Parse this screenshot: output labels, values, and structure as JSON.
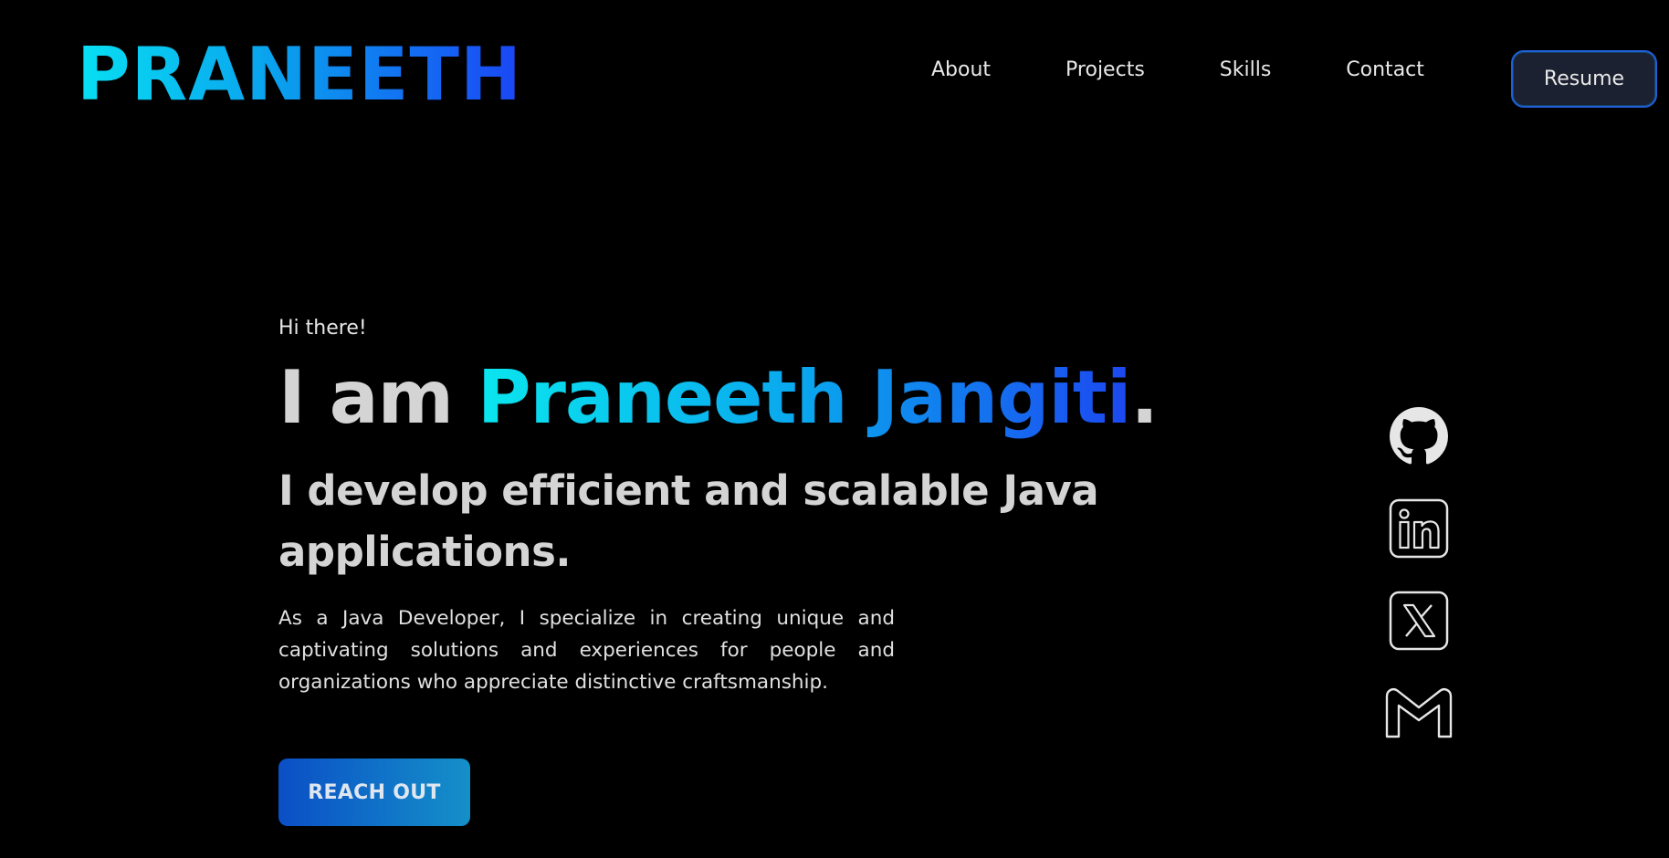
{
  "header": {
    "logo": "PRANEETH",
    "nav": [
      "About",
      "Projects",
      "Skills",
      "Contact"
    ],
    "resume_label": "Resume"
  },
  "hero": {
    "greeting": "Hi there!",
    "headline_prefix": "I am ",
    "headline_name": "Praneeth Jangiti",
    "headline_suffix": ".",
    "subheadline": "I develop efficient and scalable Java applications.",
    "description": "As a Java Developer, I specialize in creating unique and captivating solutions and experiences for people and organizations who appreciate distinctive craftsmanship.",
    "cta_label": "REACH OUT"
  },
  "social": {
    "icons": [
      "github-icon",
      "linkedin-icon",
      "x-twitter-icon",
      "gmail-icon"
    ],
    "icon_color": "#e6e6e6"
  },
  "colors": {
    "background": "#000000",
    "gradient_start": "#08e0f2",
    "gradient_end": "#1a46f5",
    "cta_start": "#0b4fc6",
    "cta_end": "#1490c9",
    "resume_bg": "#1b2130",
    "resume_border": "#1f5fd8"
  }
}
